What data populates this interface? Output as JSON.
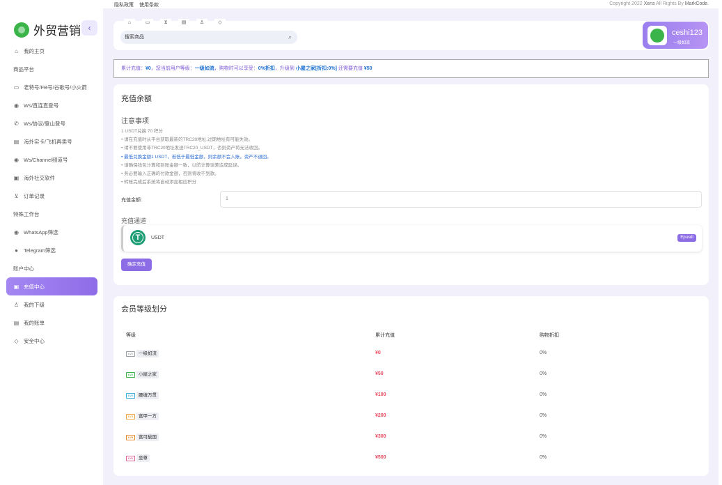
{
  "brand": {
    "name": "外贸营销",
    "collapse_icon": "chevron-left-icon"
  },
  "sidebar": {
    "items": [
      {
        "type": "item",
        "label": "我的主页",
        "icon": "home-icon"
      },
      {
        "type": "section",
        "label": "商品平台"
      },
      {
        "type": "item",
        "label": "老特号/FB号/谷歌号/小火箭",
        "icon": "chat-icon"
      },
      {
        "type": "item",
        "label": "Ws/直连直登号",
        "icon": "whatsapp-icon"
      },
      {
        "type": "item",
        "label": "Ws/协议/登山登号",
        "icon": "phone-icon"
      },
      {
        "type": "item",
        "label": "海外实卡/飞机再卖号",
        "icon": "doc-icon"
      },
      {
        "type": "item",
        "label": "Ws/Channel频道号",
        "icon": "whatsapp-icon"
      },
      {
        "type": "item",
        "label": "海外社交软件",
        "icon": "facebook-icon"
      },
      {
        "type": "item",
        "label": "订单记录",
        "icon": "cart-icon"
      },
      {
        "type": "section",
        "label": "特殊工作台"
      },
      {
        "type": "item",
        "label": "WhatsApp筛选",
        "icon": "whatsapp-icon"
      },
      {
        "type": "item",
        "label": "Telegram筛选",
        "icon": "telegram-icon"
      },
      {
        "type": "section",
        "label": "账户中心"
      },
      {
        "type": "item",
        "label": "充值中心",
        "icon": "wallet-icon",
        "active": true
      },
      {
        "type": "item",
        "label": "我的下级",
        "icon": "user-icon"
      },
      {
        "type": "item",
        "label": "我的账单",
        "icon": "bill-icon"
      },
      {
        "type": "item",
        "label": "安全中心",
        "icon": "shield-icon"
      }
    ]
  },
  "topbar": {
    "links": [
      "隐私政策",
      "使用条款"
    ],
    "copyright_prefix": "Copyright 2022 ",
    "copyright_brand": "Xens",
    "copyright_suffix": " All Rights By ",
    "copyright_author": "MarkCode."
  },
  "header": {
    "quick_icons": [
      "home-icon",
      "image-icon",
      "cart-icon",
      "doc-icon",
      "user-icon",
      "shield-icon"
    ],
    "search_placeholder": "搜索商品",
    "user": {
      "name": "ceshi123",
      "level": "一级如流"
    }
  },
  "notice": {
    "p1": "累计充值：",
    "v1": "¥0",
    "p2": "，您当前用户等级：",
    "v2": "一级如流",
    "p3": "，购物时可以享受：",
    "v3": "0%折扣",
    "p4": "，升级到 ",
    "v4": "小屋之家[折扣:0%]",
    "p5": " 还需要充值 ",
    "v5": "¥50"
  },
  "recharge": {
    "title": "充值余额",
    "notes_heading": "注意事项",
    "notes": [
      {
        "text": "1 USDT兑换 70 积分"
      },
      {
        "text": "• 请在充值时从平台获取最新的TRC20地址,过期地址有可能失效。"
      },
      {
        "text": "• 请不要使用非TRC20地址发送TRC20_USDT，否则资产将无法收回。"
      },
      {
        "text": "• 最低兑换金额1 USDT，若低于最低金额，则余额不会入账，资产不退回。",
        "blue": true
      },
      {
        "text": "• 请确保钱包计算和到账金额一致，以防计算误差造成延误。"
      },
      {
        "text": "• 务必要输入正确的付款金额，否则将收不到款。"
      },
      {
        "text": "• 转账完成后系统将自动添加相应积分"
      }
    ],
    "amount_label": "充值金额:",
    "amount_value": "1",
    "channel_label": "充值通道",
    "channel": {
      "name": "USDT",
      "badge": "Epusdt",
      "icon": "tether-icon"
    },
    "confirm_label": "确定充值"
  },
  "levels": {
    "title": "会员等级划分",
    "headers": [
      "等级",
      "累计充值",
      "购物折扣"
    ],
    "rows": [
      {
        "badge": "LV1",
        "name": "一级如流",
        "amount": "¥0",
        "discount": "0%",
        "color": "#9aa0a6"
      },
      {
        "badge": "LV2",
        "name": "小屋之家",
        "amount": "¥50",
        "discount": "0%",
        "color": "#3bb54a"
      },
      {
        "badge": "LV3",
        "name": "腰缠万贯",
        "amount": "¥100",
        "discount": "0%",
        "color": "#3fa9d9"
      },
      {
        "badge": "LV4",
        "name": "富甲一方",
        "amount": "¥200",
        "discount": "0%",
        "color": "#f0a23b"
      },
      {
        "badge": "LV5",
        "name": "富可敌国",
        "amount": "¥300",
        "discount": "0%",
        "color": "#e8882a"
      },
      {
        "badge": "LV6",
        "name": "至尊",
        "amount": "¥500",
        "discount": "0%",
        "color": "#e0609c"
      }
    ]
  }
}
